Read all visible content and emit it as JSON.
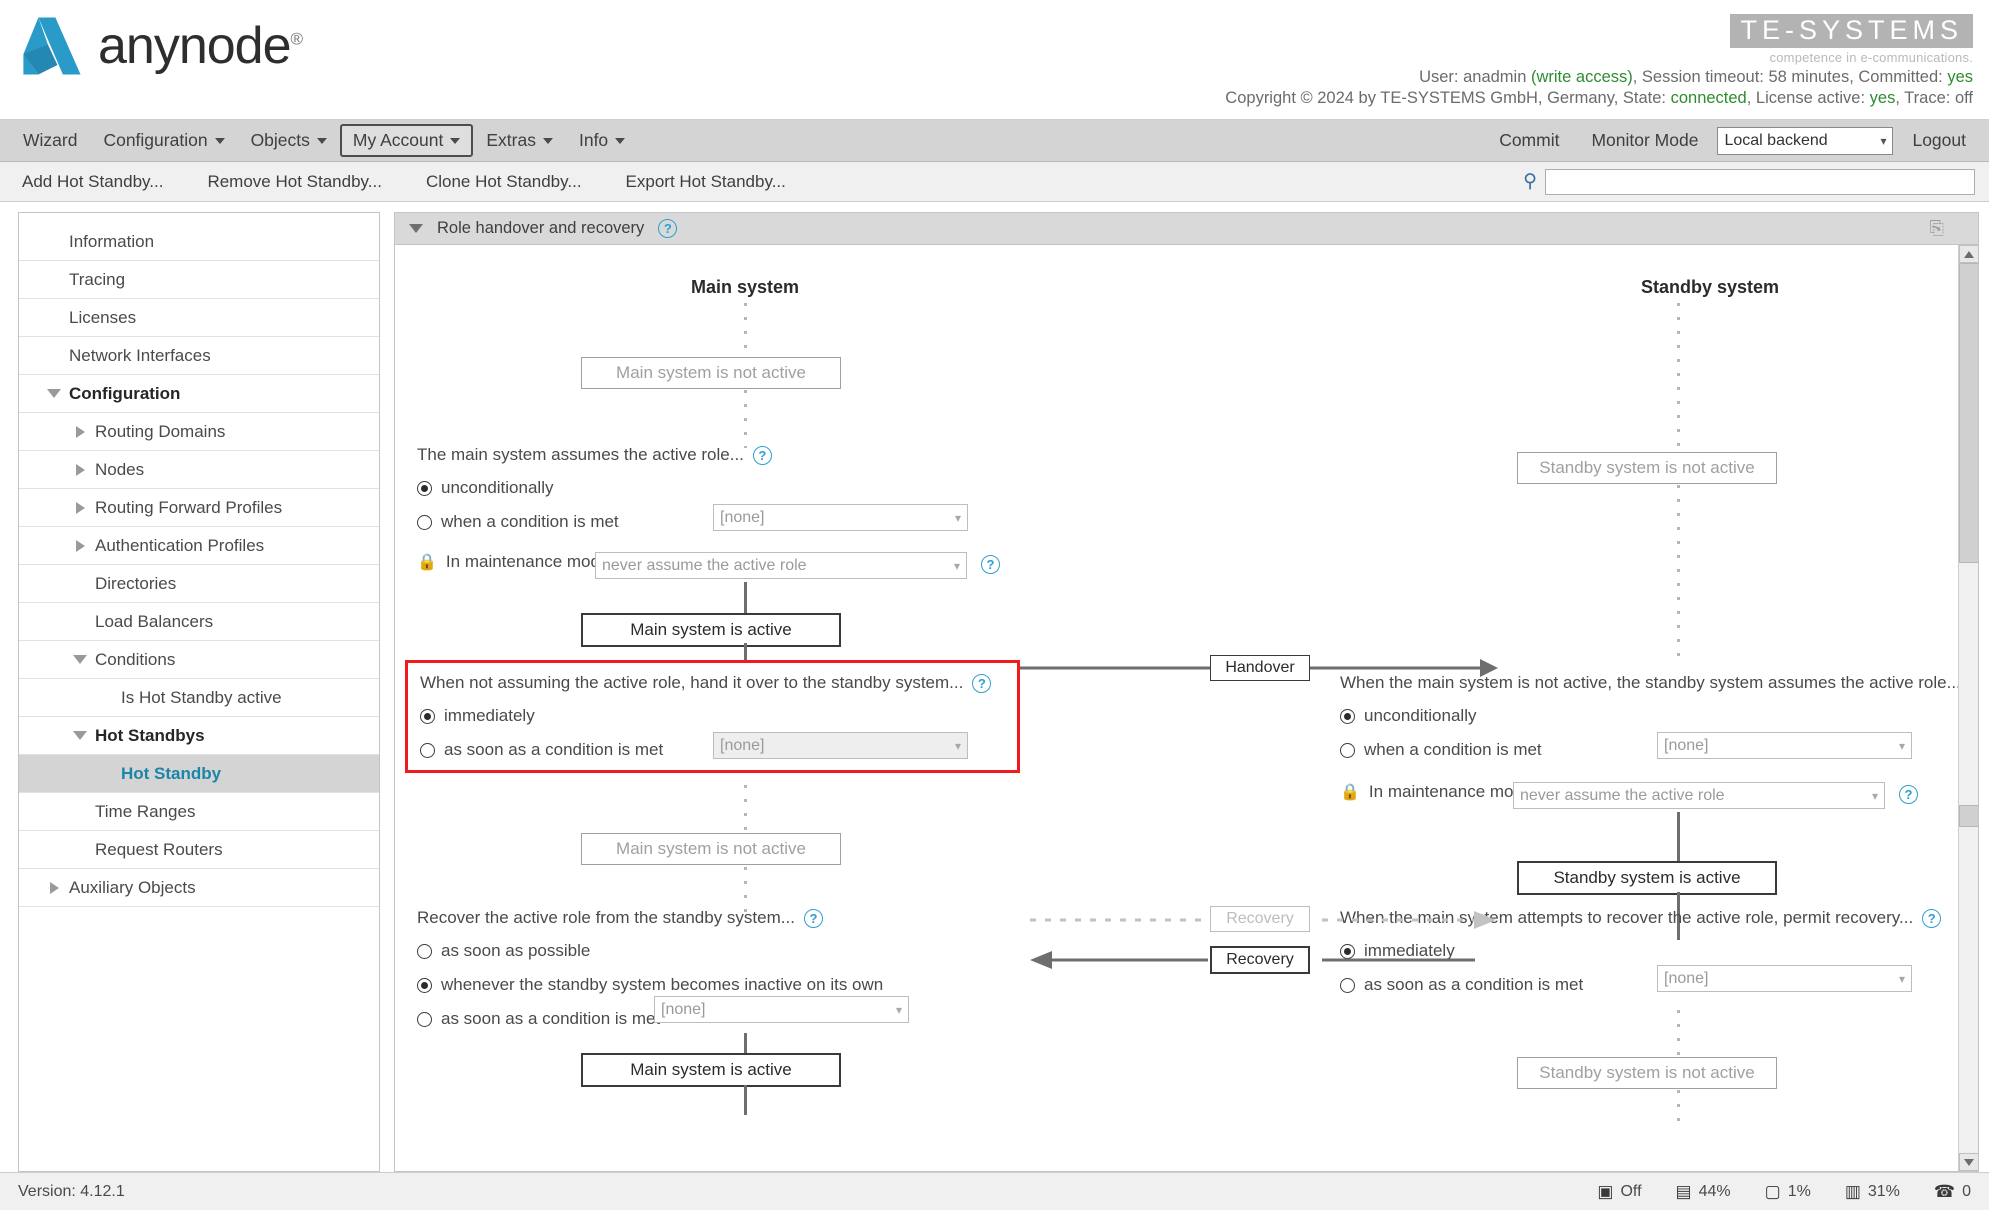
{
  "app": {
    "logo_text": "anynode",
    "logo_reg": "®",
    "brand_name": "TE-SYSTEMS",
    "brand_tagline": "competence in e-communications.",
    "status_line_1_prefix": "User: anadmin ",
    "status_write_access": "(write access)",
    "status_line_1_mid": ", Session timeout: 58 minutes, Committed: ",
    "status_committed": "yes",
    "copyright_prefix": "Copyright © 2024 by TE-SYSTEMS GmbH, Germany, State: ",
    "state_value": "connected",
    "copyright_mid": ", License active: ",
    "license_value": "yes",
    "copyright_suffix": ", Trace: off"
  },
  "menubar": {
    "items": [
      {
        "label": "Wizard",
        "caret": false,
        "active": false
      },
      {
        "label": "Configuration",
        "caret": true,
        "active": false
      },
      {
        "label": "Objects",
        "caret": true,
        "active": false
      },
      {
        "label": "My Account",
        "caret": true,
        "active": true
      },
      {
        "label": "Extras",
        "caret": true,
        "active": false
      },
      {
        "label": "Info",
        "caret": true,
        "active": false
      }
    ],
    "commit": "Commit",
    "monitor_mode": "Monitor Mode",
    "backend_selected": "Local backend",
    "logout": "Logout"
  },
  "toolbar": {
    "items": [
      "Add Hot Standby...",
      "Remove Hot Standby...",
      "Clone Hot Standby...",
      "Export Hot Standby..."
    ],
    "search_value": "",
    "search_placeholder": ""
  },
  "sidebar": {
    "items": [
      {
        "label": "Information",
        "level": 0,
        "twisty": "none",
        "bold": false,
        "selected": false
      },
      {
        "label": "Tracing",
        "level": 0,
        "twisty": "none",
        "bold": false,
        "selected": false
      },
      {
        "label": "Licenses",
        "level": 0,
        "twisty": "none",
        "bold": false,
        "selected": false
      },
      {
        "label": "Network Interfaces",
        "level": 0,
        "twisty": "none",
        "bold": false,
        "selected": false
      },
      {
        "label": "Configuration",
        "level": 0,
        "twisty": "down",
        "bold": true,
        "selected": false
      },
      {
        "label": "Routing Domains",
        "level": 1,
        "twisty": "right",
        "bold": false,
        "selected": false
      },
      {
        "label": "Nodes",
        "level": 1,
        "twisty": "right",
        "bold": false,
        "selected": false
      },
      {
        "label": "Routing Forward Profiles",
        "level": 1,
        "twisty": "right",
        "bold": false,
        "selected": false
      },
      {
        "label": "Authentication Profiles",
        "level": 1,
        "twisty": "right",
        "bold": false,
        "selected": false
      },
      {
        "label": "Directories",
        "level": 1,
        "twisty": "none",
        "bold": false,
        "selected": false
      },
      {
        "label": "Load Balancers",
        "level": 1,
        "twisty": "none",
        "bold": false,
        "selected": false
      },
      {
        "label": "Conditions",
        "level": 1,
        "twisty": "down",
        "bold": false,
        "selected": false
      },
      {
        "label": "Is Hot Standby active",
        "level": 2,
        "twisty": "none",
        "bold": false,
        "selected": false
      },
      {
        "label": "Hot Standbys",
        "level": 1,
        "twisty": "down",
        "bold": true,
        "selected": false
      },
      {
        "label": "Hot Standby",
        "level": 2,
        "twisty": "none",
        "bold": true,
        "selected": true
      },
      {
        "label": "Time Ranges",
        "level": 1,
        "twisty": "none",
        "bold": false,
        "selected": false
      },
      {
        "label": "Request Routers",
        "level": 1,
        "twisty": "none",
        "bold": false,
        "selected": false
      },
      {
        "label": "Auxiliary Objects",
        "level": 0,
        "twisty": "right",
        "bold": false,
        "selected": false
      }
    ]
  },
  "panel": {
    "section_title": "Role handover and recovery",
    "help_glyph": "?"
  },
  "diagram": {
    "main_column_title": "Main system",
    "standby_column_title": "Standby system",
    "main_not_active_top": "Main system is not active",
    "main_active_mid": "Main system is active",
    "main_not_active_mid": "Main system is not active",
    "main_active_bottom": "Main system is active",
    "standby_not_active_top": "Standby system is not active",
    "standby_active_mid": "Standby system is active",
    "standby_not_active_bottom": "Standby system is not active",
    "handover_tag": "Handover",
    "recovery_tag_dotted": "Recovery",
    "recovery_tag_solid": "Recovery",
    "main_assume": {
      "question": "The main system assumes the active role...",
      "opt1": "unconditionally",
      "opt1_selected": true,
      "opt2": "when a condition is met",
      "opt2_selected": false,
      "opt2_value": "[none]",
      "maintenance_label": "In maintenance mode",
      "maintenance_value": "never assume the active role"
    },
    "main_handover": {
      "question": "When not assuming the active role, hand it over to the standby system...",
      "opt1": "immediately",
      "opt1_selected": true,
      "opt2": "as soon as a condition is met",
      "opt2_selected": false,
      "opt2_value": "[none]",
      "highlighted": true,
      "highlight_color": "#ee1c1c"
    },
    "main_recover": {
      "question": "Recover the active role from the standby system...",
      "opt1": "as soon as possible",
      "opt1_selected": false,
      "opt2": "whenever the standby system becomes inactive on its own",
      "opt2_selected": true,
      "opt3": "as soon as a condition is met",
      "opt3_selected": false,
      "opt3_value": "[none]"
    },
    "standby_assume": {
      "question": "When the main system is not active, the standby system assumes the active role...",
      "opt1": "unconditionally",
      "opt1_selected": true,
      "opt2": "when a condition is met",
      "opt2_selected": false,
      "opt2_value": "[none]",
      "maintenance_label": "In maintenance mode",
      "maintenance_value": "never assume the active role"
    },
    "standby_permit": {
      "question": "When the main system attempts to recover the active role, permit recovery...",
      "opt1": "immediately",
      "opt1_selected": true,
      "opt2": "as soon as a condition is met",
      "opt2_selected": false,
      "opt2_value": "[none]"
    }
  },
  "statusbar": {
    "version": "Version: 4.12.1",
    "metrics": [
      {
        "icon": "monitor-icon",
        "value": "Off"
      },
      {
        "icon": "database-icon",
        "value": "44%"
      },
      {
        "icon": "cpu-icon",
        "value": "1%"
      },
      {
        "icon": "memory-icon",
        "value": "31%"
      },
      {
        "icon": "calls-icon",
        "value": "0"
      }
    ]
  }
}
